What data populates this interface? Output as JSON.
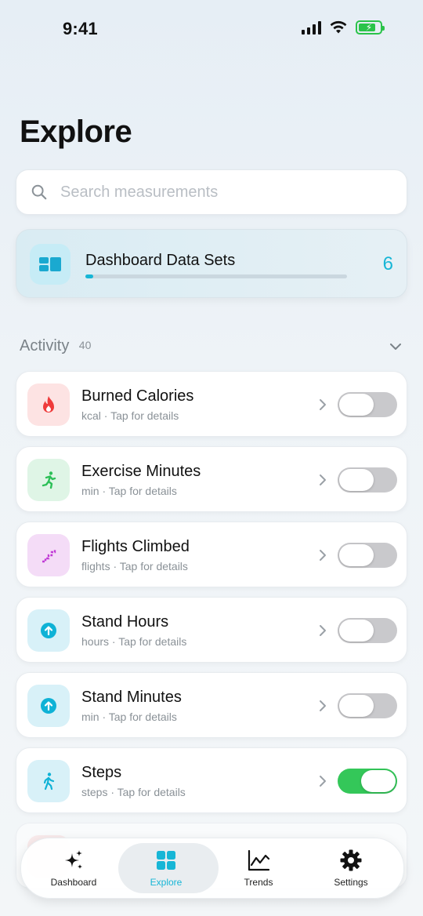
{
  "status": {
    "time": "9:41"
  },
  "page": {
    "title": "Explore"
  },
  "search": {
    "placeholder": "Search measurements"
  },
  "dashboard": {
    "label": "Dashboard Data Sets",
    "count": "6",
    "progress": 0.03,
    "accent": "#17b6d6"
  },
  "section": {
    "name": "Activity",
    "count": "40"
  },
  "rows": [
    {
      "title": "Burned Calories",
      "subtitle": "kcal · Tap for details",
      "icon": "flame-icon",
      "on": false
    },
    {
      "title": "Exercise Minutes",
      "subtitle": "min · Tap for details",
      "icon": "running-icon",
      "on": false
    },
    {
      "title": "Flights Climbed",
      "subtitle": "flights · Tap for details",
      "icon": "stairs-icon",
      "on": false
    },
    {
      "title": "Stand Hours",
      "subtitle": "hours · Tap for details",
      "icon": "arrow-up-circle-icon",
      "on": false
    },
    {
      "title": "Stand Minutes",
      "subtitle": "min · Tap for details",
      "icon": "arrow-up-circle-icon",
      "on": false
    },
    {
      "title": "Steps",
      "subtitle": "steps · Tap for details",
      "icon": "walking-icon",
      "on": true
    }
  ],
  "tabs": [
    {
      "label": "Dashboard",
      "icon": "sparkles-icon"
    },
    {
      "label": "Explore",
      "icon": "grid-icon",
      "active": true
    },
    {
      "label": "Trends",
      "icon": "chart-line-icon"
    },
    {
      "label": "Settings",
      "icon": "gear-icon"
    }
  ],
  "colors": {
    "toggle_on": "#34c759",
    "toggle_off": "#c9c9cc",
    "accent": "#17b6d6"
  }
}
